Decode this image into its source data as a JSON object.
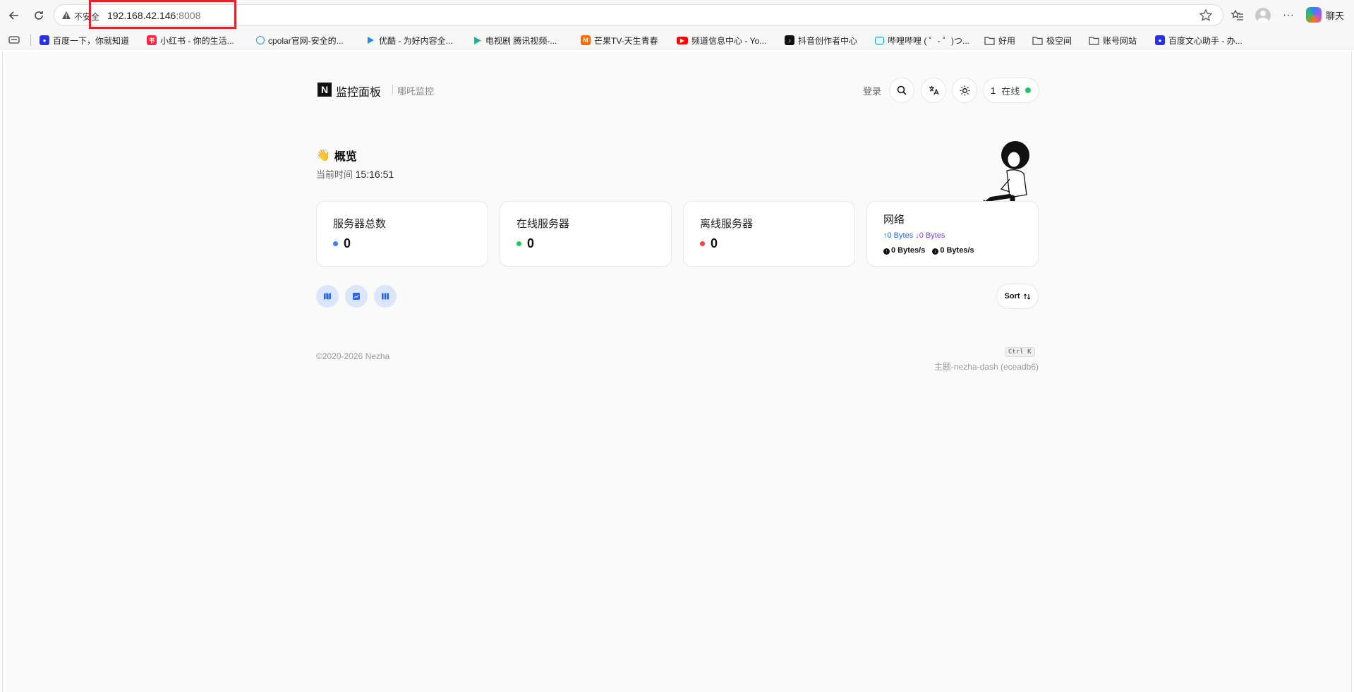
{
  "browser": {
    "insecure_label": "不安全",
    "url_host": "192.168.42.146",
    "url_port": ":8008",
    "chat_label": "聊天"
  },
  "bookmarks": [
    {
      "label": "百度一下，你就知道",
      "icon": "baidu-paw-icon",
      "color": "#2932e1"
    },
    {
      "label": "小红书 - 你的生活...",
      "icon": "xiaohongshu-icon",
      "color": "#ff2442"
    },
    {
      "label": "cpolar官网-安全的...",
      "icon": "cpolar-icon",
      "color": "#1e9be9"
    },
    {
      "label": "优酷 - 为好内容全...",
      "icon": "youku-icon",
      "color": "#1e8cf5"
    },
    {
      "label": "电视剧 腾讯视频-...",
      "icon": "tencent-video-icon",
      "color": "#22c55e"
    },
    {
      "label": "芒果TV-天生青春",
      "icon": "mangotv-icon",
      "color": "#ff6a00"
    },
    {
      "label": "频道信息中心 - Yo...",
      "icon": "youtube-icon",
      "color": "#ff0000"
    },
    {
      "label": "抖音创作者中心",
      "icon": "douyin-icon",
      "color": "#111111"
    },
    {
      "label": "哔哩哔哩 ( ゜- ゜)つ...",
      "icon": "bilibili-icon",
      "color": "#00a1d6"
    },
    {
      "label": "好用",
      "icon": "folder-icon",
      "color": "#555555"
    },
    {
      "label": "极空间",
      "icon": "folder-icon",
      "color": "#555555"
    },
    {
      "label": "账号网站",
      "icon": "folder-icon",
      "color": "#555555"
    },
    {
      "label": "百度文心助手 - 办...",
      "icon": "baidu-paw-icon",
      "color": "#2932e1"
    }
  ],
  "header": {
    "brand": "监控面板",
    "subtitle": "哪吒监控",
    "login": "登录",
    "online_count": "1",
    "online_label": "在线"
  },
  "overview": {
    "title": "概览",
    "time_label": "当前时间",
    "time_value": "15:16:51"
  },
  "cards": {
    "total": {
      "title": "服务器总数",
      "value": "0",
      "dot_color": "#3b82f6"
    },
    "online": {
      "title": "在线服务器",
      "value": "0",
      "dot_color": "#22c55e"
    },
    "offline": {
      "title": "离线服务器",
      "value": "0",
      "dot_color": "#ef4444"
    },
    "network": {
      "title": "网络",
      "up": "↑0 Bytes",
      "down": "↓0 Bytes",
      "up_speed": "0 Bytes/s",
      "down_speed": "0 Bytes/s"
    }
  },
  "controls": {
    "sort_label": "Sort"
  },
  "footer": {
    "copyright": "©2020-2026 Nezha",
    "shortcut": "Ctrl K",
    "theme": "主题-nezha-dash (eceadb6)"
  },
  "colors": {
    "accent_blue": "#2563eb",
    "view_btn_bg": "#dbe6fb",
    "highlight_red": "#e0242c"
  }
}
